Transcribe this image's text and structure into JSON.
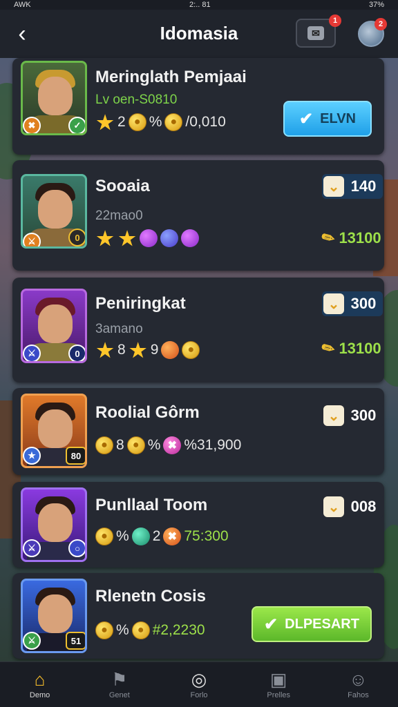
{
  "status_bar": {
    "left": "AWK",
    "time": "2:.. 81",
    "battery": "37%"
  },
  "header": {
    "title": "Idomasia",
    "message_badge": "1",
    "profile_badge": "2"
  },
  "cards": [
    {
      "title": "Meringlath Pemjaai",
      "subtitle": "Lv oen-S0810",
      "rewards": {
        "a": "2",
        "b": "%",
        "c": "/0,010"
      },
      "button_label": "ELVN"
    },
    {
      "title": "Sooaia",
      "subtitle": "22mao0",
      "cost": "140",
      "side_reward": "13100",
      "corner": "0"
    },
    {
      "title": "Peniringkat",
      "subtitle": "3amano",
      "rewards": {
        "a": "8",
        "b": "9"
      },
      "cost": "300",
      "side_reward": "13100",
      "corner": "0"
    },
    {
      "title": "Roolial Gôrm",
      "rewards": {
        "a": "8",
        "b": "%",
        "c": "%31,900"
      },
      "cost": "300",
      "corner": "80"
    },
    {
      "title": "Punllaal Toom",
      "rewards": {
        "a": "%",
        "b": "2",
        "c": "75:300"
      },
      "cost": "008"
    },
    {
      "title": "Rlenetn Cosis",
      "rewards": {
        "a": "%",
        "b": "#2,2230"
      },
      "button_label": "DLPESART",
      "corner": "51"
    }
  ],
  "nav": [
    {
      "label": "Demo",
      "icon": "home-icon"
    },
    {
      "label": "Genet",
      "icon": "map-icon"
    },
    {
      "label": "Forlo",
      "icon": "compass-icon"
    },
    {
      "label": "Prelles",
      "icon": "book-icon"
    },
    {
      "label": "Fahos",
      "icon": "profile-icon"
    }
  ]
}
